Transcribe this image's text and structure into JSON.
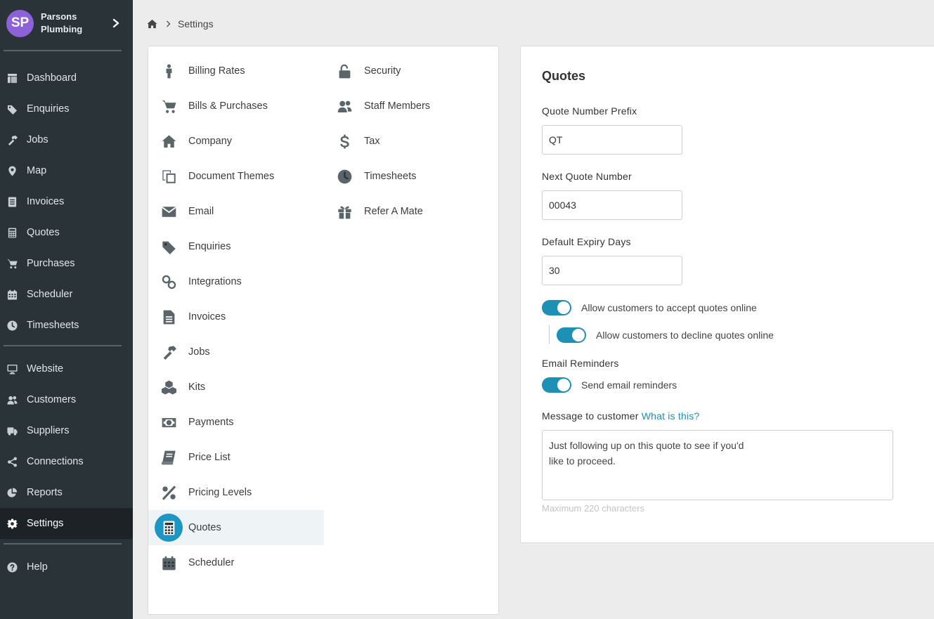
{
  "brand": {
    "initials": "SP",
    "name": "Parsons Plumbing",
    "avatar_color": "#8d62d8"
  },
  "breadcrumb": {
    "current": "Settings"
  },
  "sidebar": {
    "group1": [
      {
        "label": "Dashboard",
        "icon": "dashboard-icon"
      },
      {
        "label": "Enquiries",
        "icon": "tags-icon"
      },
      {
        "label": "Jobs",
        "icon": "hammer-icon"
      },
      {
        "label": "Map",
        "icon": "map-marker-icon"
      },
      {
        "label": "Invoices",
        "icon": "invoice-icon"
      },
      {
        "label": "Quotes",
        "icon": "calculator-icon"
      },
      {
        "label": "Purchases",
        "icon": "cart-icon"
      },
      {
        "label": "Scheduler",
        "icon": "calendar-icon"
      },
      {
        "label": "Timesheets",
        "icon": "clock-icon"
      }
    ],
    "group2": [
      {
        "label": "Website",
        "icon": "monitor-icon"
      },
      {
        "label": "Customers",
        "icon": "users-icon"
      },
      {
        "label": "Suppliers",
        "icon": "truck-icon"
      },
      {
        "label": "Connections",
        "icon": "share-icon"
      },
      {
        "label": "Reports",
        "icon": "pie-chart-icon"
      },
      {
        "label": "Settings",
        "icon": "gear-icon",
        "active": true
      }
    ],
    "group3": [
      {
        "label": "Help",
        "icon": "question-icon"
      }
    ]
  },
  "settings_menu": {
    "left": [
      {
        "label": "Billing Rates",
        "icon": "person-icon"
      },
      {
        "label": "Bills & Purchases",
        "icon": "cart-icon"
      },
      {
        "label": "Company",
        "icon": "home-icon"
      },
      {
        "label": "Document Themes",
        "icon": "copy-icon"
      },
      {
        "label": "Email",
        "icon": "envelope-icon"
      },
      {
        "label": "Enquiries",
        "icon": "tags-icon"
      },
      {
        "label": "Integrations",
        "icon": "link-icon"
      },
      {
        "label": "Invoices",
        "icon": "document-icon"
      },
      {
        "label": "Jobs",
        "icon": "hammer-icon"
      },
      {
        "label": "Kits",
        "icon": "cubes-icon"
      },
      {
        "label": "Payments",
        "icon": "money-icon"
      },
      {
        "label": "Price List",
        "icon": "book-icon"
      },
      {
        "label": "Pricing Levels",
        "icon": "percent-icon"
      },
      {
        "label": "Quotes",
        "icon": "calculator-icon",
        "active": true
      },
      {
        "label": "Scheduler",
        "icon": "calendar-icon"
      }
    ],
    "right": [
      {
        "label": "Security",
        "icon": "unlock-icon"
      },
      {
        "label": "Staff Members",
        "icon": "users-icon"
      },
      {
        "label": "Tax",
        "icon": "dollar-icon"
      },
      {
        "label": "Timesheets",
        "icon": "clock-icon"
      },
      {
        "label": "Refer A Mate",
        "icon": "gift-icon"
      }
    ]
  },
  "quotes_form": {
    "title": "Quotes",
    "prefix_label": "Quote Number Prefix",
    "prefix_value": "QT",
    "next_number_label": "Next Quote Number",
    "next_number_value": "00043",
    "expiry_label": "Default Expiry Days",
    "expiry_value": "30",
    "accept_online_label": "Allow customers to accept quotes online",
    "accept_online_on": true,
    "decline_online_label": "Allow customers to decline quotes online",
    "decline_online_on": true,
    "email_reminders_heading": "Email Reminders",
    "send_reminders_label": "Send email reminders",
    "send_reminders_on": true,
    "message_label": "Message to customer",
    "message_help_link": "What is this?",
    "message_value": "Just following up on this quote to see if you'd\nlike to proceed.",
    "message_hint": "Maximum 220 characters"
  },
  "colors": {
    "sidebar_bg": "#2a3338",
    "accent": "#1e8fb5",
    "active_menu_bg": "#eef3f6"
  }
}
